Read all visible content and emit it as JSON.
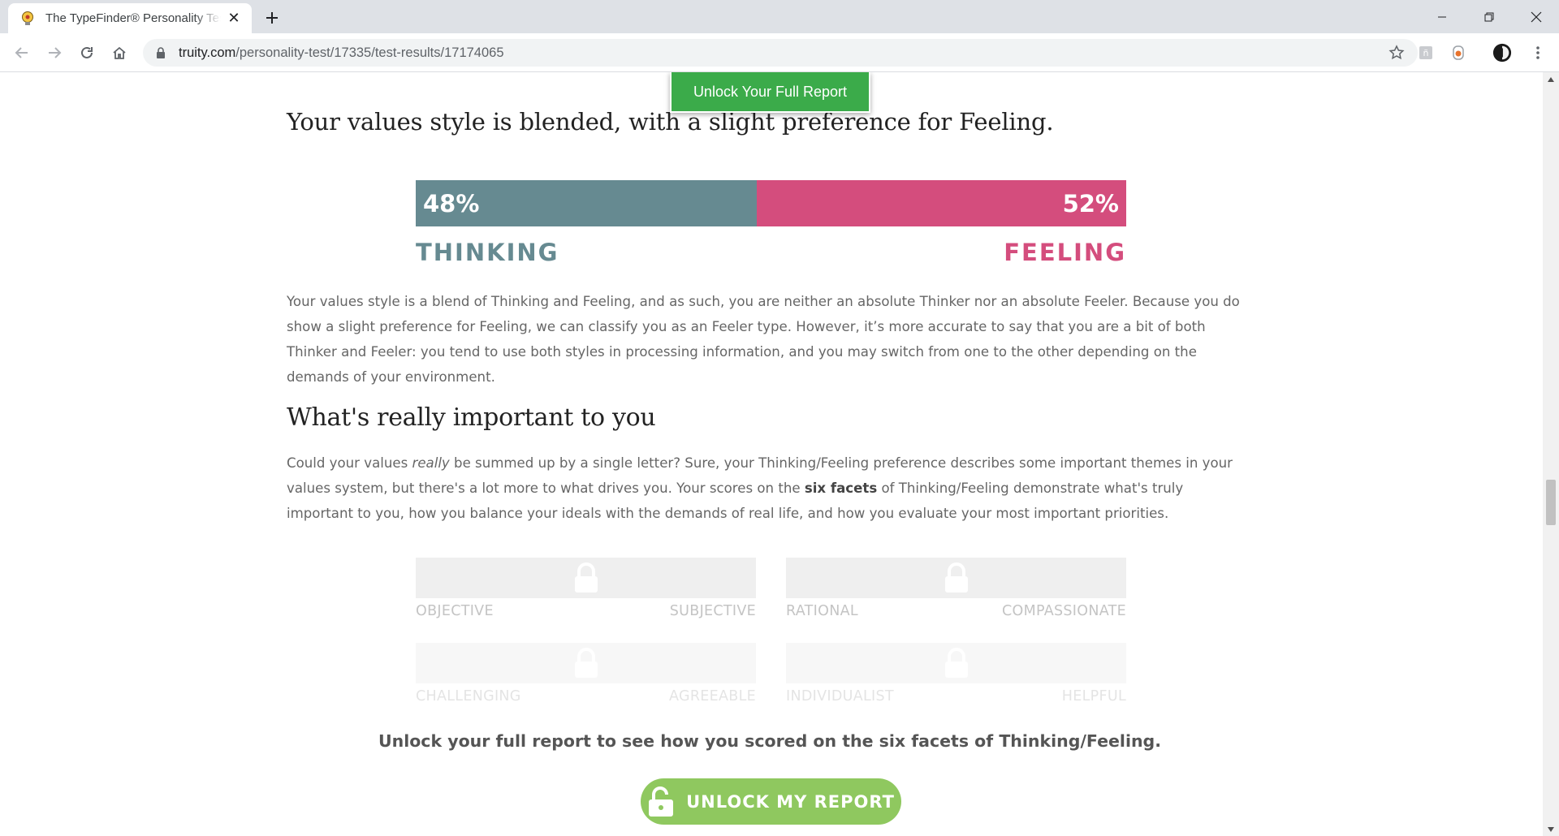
{
  "browser": {
    "tab_title": "The TypeFinder® Personality Test",
    "url_host": "truity.com",
    "url_path": "/personality-test/17335/test-results/17174065"
  },
  "page": {
    "floating_button": "Unlock Your Full Report",
    "heading_values": "Your values style is blended, with a slight preference for Feeling.",
    "score": {
      "left_percent": 48,
      "right_percent": 52,
      "left_label_value": "48%",
      "right_label_value": "52%",
      "left_name": "THINKING",
      "right_name": "FEELING",
      "left_color": "#668a91",
      "right_color": "#d44d7d"
    },
    "paragraph_blend": "Your values style is a blend of Thinking and Feeling, and as such, you are neither an absolute Thinker nor an absolute Feeler. Because you do show a slight preference for Feeling, we can classify you as an Feeler type. However, it’s more accurate to say that you are a bit of both Thinker and Feeler: you tend to use both styles in processing information, and you may switch from one to the other depending on the demands of your environment.",
    "heading_important": "What's really important to you",
    "paragraph_important": {
      "part1": "Could your values ",
      "em": "really",
      "part2": " be summed up by a single letter? Sure, your Thinking/Feeling preference describes some important themes in your values system, but there's a lot more to what drives you. Your scores on the ",
      "bold": "six facets",
      "part3": " of Thinking/Feeling demonstrate what's truly important to you, how you balance your ideals with the demands of real life, and how you evaluate your most important priorities."
    },
    "facets": [
      {
        "left": "OBJECTIVE",
        "right": "SUBJECTIVE"
      },
      {
        "left": "RATIONAL",
        "right": "COMPASSIONATE"
      },
      {
        "left": "CHALLENGING",
        "right": "AGREEABLE"
      },
      {
        "left": "INDIVIDUALIST",
        "right": "HELPFUL"
      }
    ],
    "unlock_message": "Unlock your full report to see how you scored on the six facets of Thinking/Feeling.",
    "unlock_button": "UNLOCK MY REPORT"
  }
}
